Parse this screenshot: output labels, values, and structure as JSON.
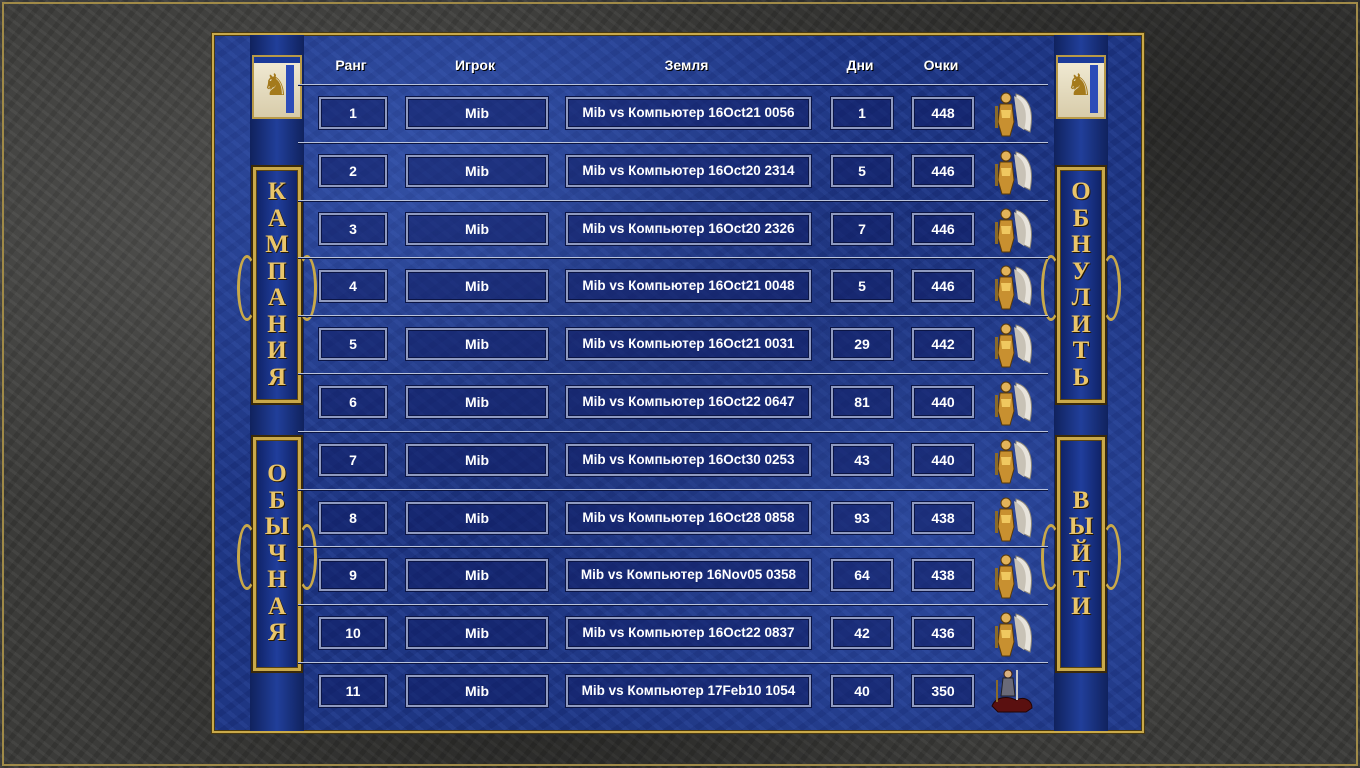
{
  "headers": {
    "rank": "Ранг",
    "player": "Игрок",
    "map": "Земля",
    "days": "Дни",
    "score": "Очки"
  },
  "buttons": {
    "campaign": [
      "К",
      "А",
      "М",
      "П",
      "А",
      "Н",
      "И",
      "Я"
    ],
    "standard": [
      "О",
      "Б",
      "Ы",
      "Ч",
      "Н",
      "А",
      "Я"
    ],
    "reset": [
      "О",
      "Б",
      "Н",
      "У",
      "Л",
      "И",
      "Т",
      "Ь"
    ],
    "exit": [
      "В",
      "Ы",
      "Й",
      "Т",
      "И"
    ]
  },
  "icons": {
    "flag": "castle-griffin-banner-icon",
    "portrait": "archangel-portrait-icon",
    "portrait_last": "cavalier-portrait-icon"
  },
  "colors": {
    "panel_blue": "#1c3588",
    "gold": "#c9a94a",
    "stone": "#3a3a38"
  },
  "rows": [
    {
      "rank": "1",
      "player": "Mib",
      "map": "Mib vs Компьютер 16Oct21 0056",
      "days": "1",
      "score": "448"
    },
    {
      "rank": "2",
      "player": "Mib",
      "map": "Mib vs Компьютер 16Oct20 2314",
      "days": "5",
      "score": "446"
    },
    {
      "rank": "3",
      "player": "Mib",
      "map": "Mib vs Компьютер 16Oct20 2326",
      "days": "7",
      "score": "446"
    },
    {
      "rank": "4",
      "player": "Mib",
      "map": "Mib vs Компьютер 16Oct21 0048",
      "days": "5",
      "score": "446"
    },
    {
      "rank": "5",
      "player": "Mib",
      "map": "Mib vs Компьютер 16Oct21 0031",
      "days": "29",
      "score": "442"
    },
    {
      "rank": "6",
      "player": "Mib",
      "map": "Mib vs Компьютер 16Oct22 0647",
      "days": "81",
      "score": "440"
    },
    {
      "rank": "7",
      "player": "Mib",
      "map": "Mib vs Компьютер 16Oct30 0253",
      "days": "43",
      "score": "440"
    },
    {
      "rank": "8",
      "player": "Mib",
      "map": "Mib vs Компьютер 16Oct28 0858",
      "days": "93",
      "score": "438"
    },
    {
      "rank": "9",
      "player": "Mib",
      "map": "Mib vs Компьютер 16Nov05 0358",
      "days": "64",
      "score": "438"
    },
    {
      "rank": "10",
      "player": "Mib",
      "map": "Mib vs Компьютер 16Oct22 0837",
      "days": "42",
      "score": "436"
    },
    {
      "rank": "11",
      "player": "Mib",
      "map": "Mib vs Компьютер 17Feb10 1054",
      "days": "40",
      "score": "350"
    }
  ]
}
